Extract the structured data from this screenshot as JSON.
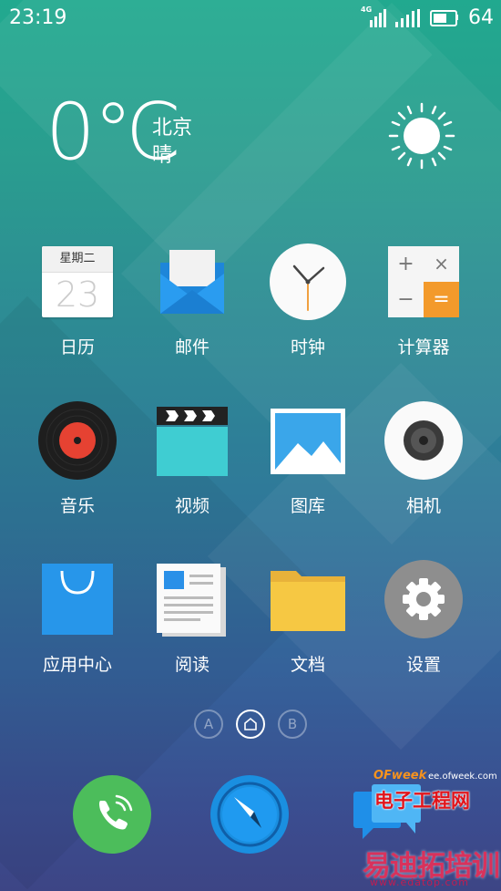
{
  "status_bar": {
    "time": "23:19",
    "network": "4G",
    "battery_level": "64"
  },
  "weather": {
    "temperature": "0℃",
    "city": "北京",
    "condition": "晴",
    "icon": "sun-icon"
  },
  "apps": [
    {
      "label": "日历",
      "icon": "calendar-icon",
      "weekday": "星期二",
      "day": "23"
    },
    {
      "label": "邮件",
      "icon": "mail-icon"
    },
    {
      "label": "时钟",
      "icon": "clock-icon"
    },
    {
      "label": "计算器",
      "icon": "calculator-icon"
    },
    {
      "label": "音乐",
      "icon": "music-icon"
    },
    {
      "label": "视频",
      "icon": "video-icon"
    },
    {
      "label": "图库",
      "icon": "gallery-icon"
    },
    {
      "label": "相机",
      "icon": "camera-icon"
    },
    {
      "label": "应用中心",
      "icon": "app-store-icon"
    },
    {
      "label": "阅读",
      "icon": "reader-icon"
    },
    {
      "label": "文档",
      "icon": "folder-icon"
    },
    {
      "label": "设置",
      "icon": "settings-icon"
    }
  ],
  "page_indicator": {
    "left": "A",
    "right": "B",
    "current": "home"
  },
  "dock": [
    {
      "icon": "phone-icon"
    },
    {
      "icon": "browser-icon"
    },
    {
      "icon": "messages-icon"
    }
  ],
  "watermark": {
    "brand": "OFweek",
    "url": "ee.ofweek.com",
    "name": "电子工程网",
    "site_cn": "易迪拓培训",
    "site_url": "www.edatop.com"
  }
}
